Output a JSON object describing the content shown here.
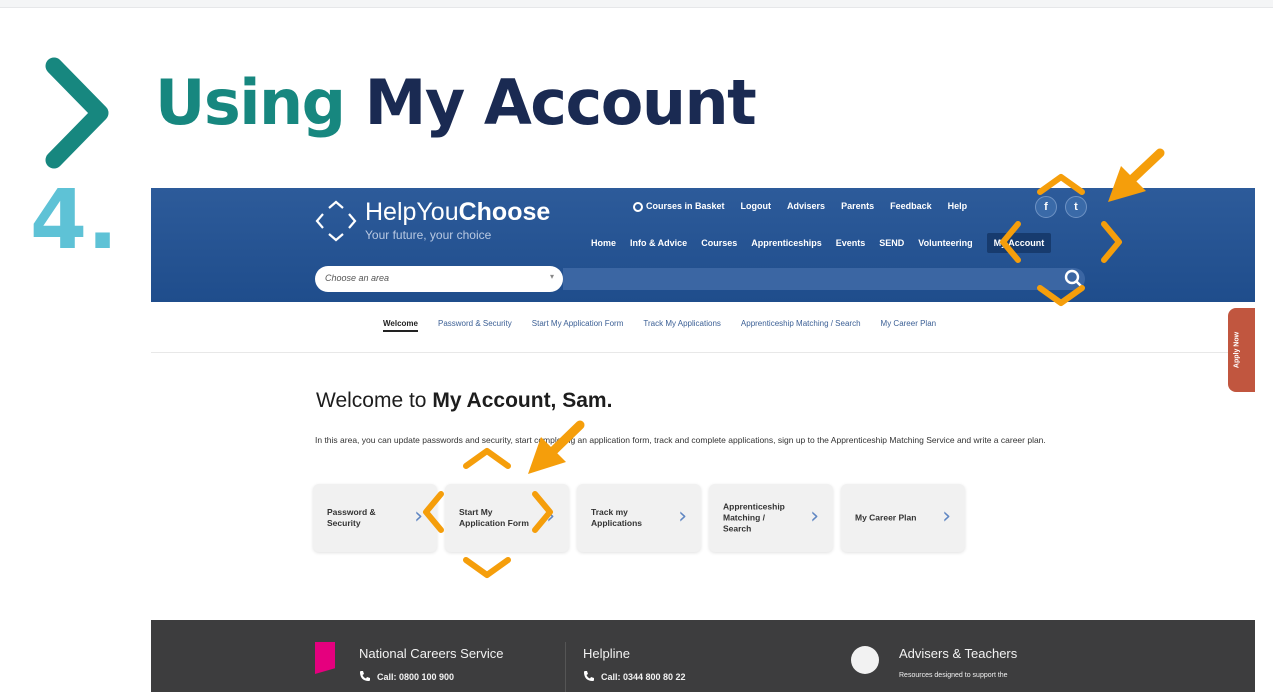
{
  "slide": {
    "title_part1": "Using",
    "title_part2": "My Account",
    "step": "4."
  },
  "site": {
    "logo_part1": "HelpYou",
    "logo_part2": "Choose",
    "tagline": "Your future, your choice",
    "util_nav": {
      "basket": "Courses in Basket",
      "logout": "Logout",
      "advisers": "Advisers",
      "parents": "Parents",
      "feedback": "Feedback",
      "help": "Help"
    },
    "social": {
      "facebook": "f",
      "twitter": "t"
    },
    "main_nav": {
      "home": "Home",
      "info": "Info & Advice",
      "courses": "Courses",
      "apprenticeships": "Apprenticeships",
      "events": "Events",
      "send": "SEND",
      "volunteering": "Volunteering",
      "my_account": "My Account"
    },
    "area_placeholder": "Choose an area",
    "sub_nav": {
      "welcome": "Welcome",
      "password": "Password & Security",
      "start_form": "Start My Application Form",
      "track": "Track My Applications",
      "matching": "Apprenticeship Matching / Search",
      "career": "My Career Plan"
    },
    "apply_tab": "Apply Now",
    "welcome_light": "Welcome to ",
    "welcome_bold": "My Account, Sam.",
    "intro": "In this area, you can update passwords and security, start completing an application form, track and complete applications, sign up to the Apprenticeship Matching Service and write a career plan.",
    "cards": {
      "password": "Password & Security",
      "start": "Start My Application Form",
      "track": "Track my Applications",
      "matching": "Apprenticeship Matching / Search",
      "career": "My Career Plan"
    },
    "footer": {
      "ncs_title": "National Careers Service",
      "ncs_call": "Call: 0800 100 900",
      "helpline_title": "Helpline",
      "helpline_call": "Call: 0344 800 80 22",
      "advisers_title": "Advisers & Teachers",
      "advisers_text": "Resources designed to support the"
    }
  },
  "colors": {
    "teal": "#17877f",
    "navy": "#1a2a52",
    "step_blue": "#5ec2d6",
    "header_blue": "#2d5b9a",
    "annotation_orange": "#f59e0b",
    "footer_dark": "#3d3d3e",
    "apply_red": "#c1563f"
  },
  "icons": [
    "chevron-right-icon",
    "logo-diamond-icon",
    "basket-icon",
    "facebook-icon",
    "twitter-icon",
    "search-icon",
    "phone-icon",
    "users-icon",
    "arrow-icon",
    "focus-chevrons-icon"
  ]
}
